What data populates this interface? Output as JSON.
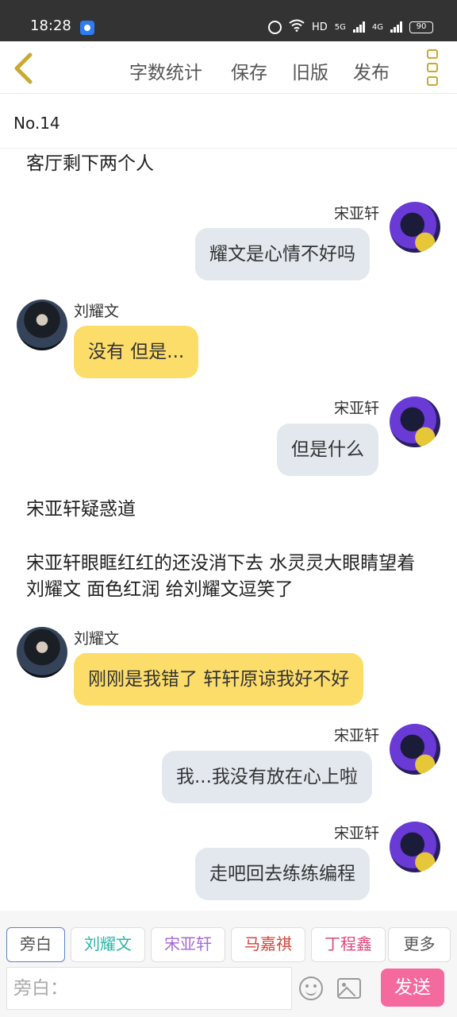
{
  "status_bar": {
    "time": "18:28",
    "network_label": "HD",
    "signal_5g": "5G",
    "signal_4g": "4G",
    "battery": "90"
  },
  "top_bar": {
    "word_count": "字数统计",
    "save": "保存",
    "old_version": "旧版",
    "publish": "发布"
  },
  "chapter": {
    "title": "No.14"
  },
  "messages": {
    "m0": {
      "text": "客厅剩下两个人"
    },
    "m1": {
      "speaker": "宋亚轩",
      "text": "耀文是心情不好吗"
    },
    "m2": {
      "speaker": "刘耀文",
      "text": "没有 但是..."
    },
    "m3": {
      "speaker": "宋亚轩",
      "text": "但是什么"
    },
    "m4": {
      "text": "宋亚轩疑惑道"
    },
    "m5": {
      "text": "宋亚轩眼眶红红的还没消下去 水灵灵大眼睛望着刘耀文 面色红润 给刘耀文逗笑了"
    },
    "m6": {
      "speaker": "刘耀文",
      "text": "刚刚是我错了 轩轩原谅我好不好"
    },
    "m7": {
      "speaker": "宋亚轩",
      "text": "我...我没有放在心上啦"
    },
    "m8": {
      "speaker": "宋亚轩",
      "text": "走吧回去练练编程"
    }
  },
  "roles": {
    "narration": {
      "label": "旁白",
      "color": "#555555"
    },
    "liu": {
      "label": "刘耀文",
      "color": "#2bb5a8"
    },
    "song": {
      "label": "宋亚轩",
      "color": "#a36ad6"
    },
    "ma": {
      "label": "马嘉祺",
      "color": "#d2473b"
    },
    "ding": {
      "label": "丁程鑫",
      "color": "#e0467d"
    },
    "more": {
      "label": "更多",
      "color": "#555555"
    }
  },
  "input": {
    "placeholder": "旁白：",
    "send_label": "发送"
  }
}
